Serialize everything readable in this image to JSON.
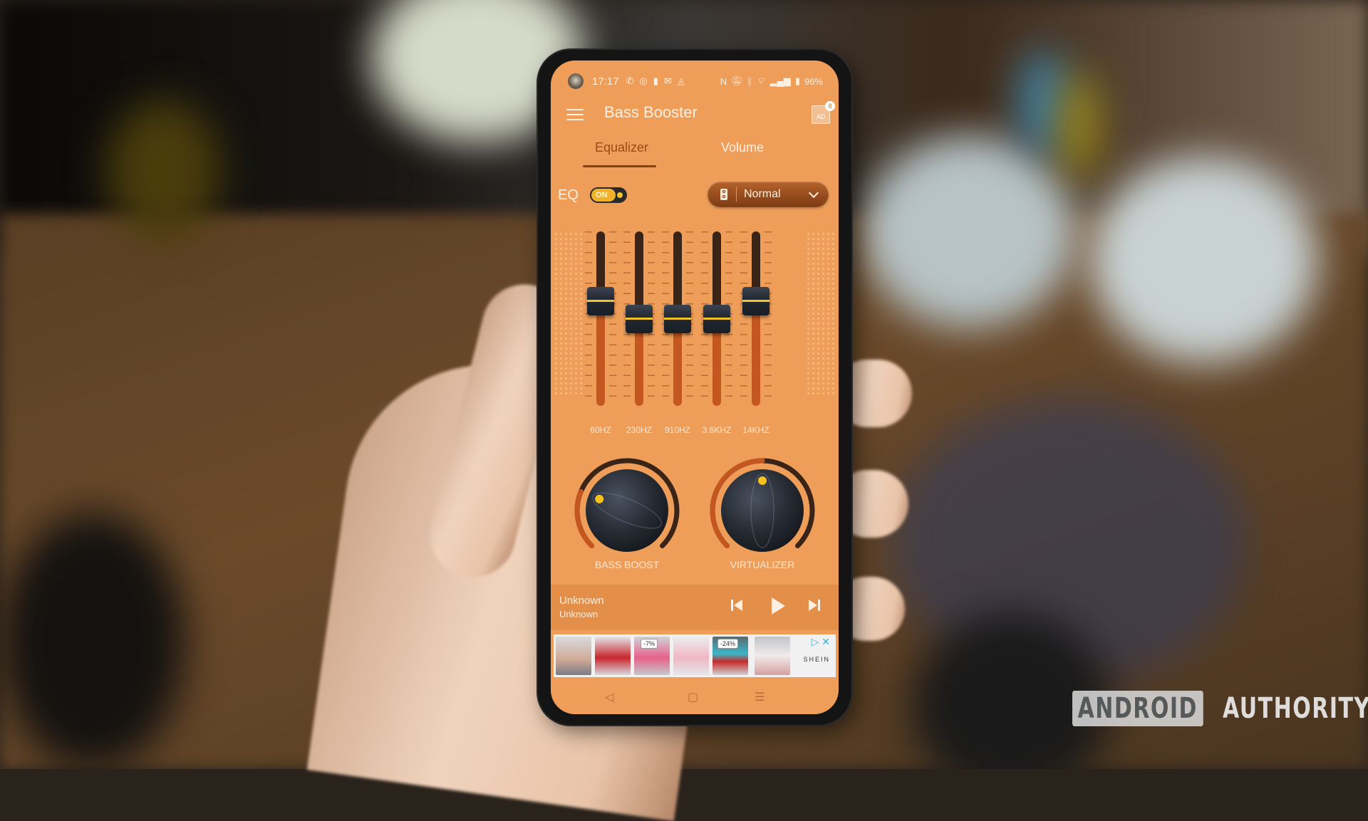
{
  "status_bar": {
    "time": "17:17",
    "notification_icons": [
      "whatsapp-icon",
      "instagram-icon",
      "tall-notif-icon",
      "mail-icon",
      "app-icon"
    ],
    "system_icons": [
      "nfc-icon",
      "mute-icon",
      "bluetooth-icon",
      "wifi-icon",
      "signal-icon",
      "battery-icon"
    ],
    "battery": "96%"
  },
  "app_bar": {
    "title": "Bass Booster",
    "ad_badge_label": "AD",
    "ad_badge_count": "8"
  },
  "tabs": [
    {
      "label": "Equalizer",
      "active": true
    },
    {
      "label": "Volume",
      "active": false
    }
  ],
  "eq": {
    "label": "EQ",
    "toggle_label": "ON",
    "enabled": true,
    "preset": "Normal",
    "bands": [
      {
        "label": "60HZ",
        "level_pct": 62
      },
      {
        "label": "230HZ",
        "level_pct": 50
      },
      {
        "label": "910HZ",
        "level_pct": 50
      },
      {
        "label": "3.6KHZ",
        "level_pct": 50
      },
      {
        "label": "14KHZ",
        "level_pct": 62
      }
    ]
  },
  "effects": [
    {
      "label": "BASS BOOST",
      "level_pct": 25
    },
    {
      "label": "VIRTUALIZER",
      "level_pct": 50
    }
  ],
  "player": {
    "title": "Unknown",
    "artist": "Unknown",
    "controls": [
      "previous",
      "play",
      "next"
    ]
  },
  "ad": {
    "brand": "SHEIN",
    "tags": [
      "-7%",
      "-24%"
    ]
  },
  "nav_bar": [
    "back",
    "home",
    "recents"
  ],
  "watermark": {
    "box": "ANDROID",
    "text": "AUTHORITY"
  },
  "colors": {
    "screen_bg": "#ef9e5a",
    "accent_dark": "#8a3f10",
    "toggle_on": "#f0b22a",
    "slider_fill": "#c4571f",
    "knob_arc_fill": "#c4571f"
  }
}
